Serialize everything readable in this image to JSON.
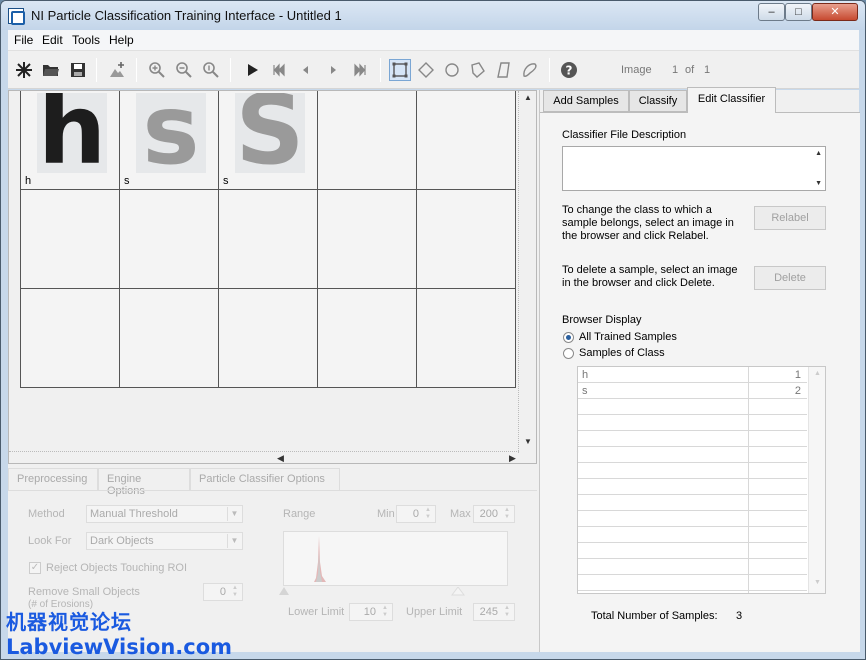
{
  "window": {
    "title": "NI Particle Classification Training Interface - Untitled 1",
    "min": "–",
    "max": "□",
    "close": "✕"
  },
  "menu": [
    "File",
    "Edit",
    "Tools",
    "Help"
  ],
  "toolbar": {
    "icons": [
      "new-icon",
      "open-icon",
      "save-icon",
      "add-samples-icon",
      "zoom-in-icon",
      "zoom-out-icon",
      "zoom-fit-icon",
      "run-icon",
      "first-icon",
      "previous-icon",
      "next-icon",
      "last-icon",
      "rectangle-roi-icon",
      "rotated-rect-icon",
      "ellipse-roi-icon",
      "polygon-icon",
      "freehand-line-icon",
      "freehand-roi-icon",
      "help-icon"
    ],
    "image_label": "Image",
    "image_index": "1",
    "image_of": "of",
    "image_total": "1"
  },
  "browser": {
    "cells": [
      {
        "glyph": "h",
        "label": "h",
        "dark": true
      },
      {
        "glyph": "s",
        "label": "s",
        "dark": false
      },
      {
        "glyph": "S",
        "label": "s",
        "dark": false
      }
    ]
  },
  "lower": {
    "tabs": [
      "Preprocessing",
      "Engine Options",
      "Particle Classifier Options"
    ],
    "method_label": "Method",
    "method_value": "Manual Threshold",
    "lookfor_label": "Look For",
    "lookfor_value": "Dark Objects",
    "reject_label": "Reject Objects Touching ROI",
    "remove_label": "Remove Small Objects",
    "remove_sub": "(# of Erosions)",
    "remove_value": "0",
    "range_label": "Range",
    "min_label": "Min",
    "min_value": "0",
    "max_label": "Max",
    "max_value": "200",
    "lower_limit_label": "Lower Limit",
    "lower_limit_value": "10",
    "upper_limit_label": "Upper Limit",
    "upper_limit_value": "245"
  },
  "right": {
    "tabs": [
      "Add Samples",
      "Classify",
      "Edit Classifier"
    ],
    "active_tab": "Edit Classifier",
    "desc_label": "Classifier File Description",
    "relabel_text": [
      "To change the class to which a",
      "sample belongs, select an image in",
      "the browser and click Relabel."
    ],
    "relabel_button": "Relabel",
    "delete_text": [
      "To delete a sample, select an image",
      "in the browser and click Delete."
    ],
    "delete_button": "Delete",
    "browser_display_label": "Browser Display",
    "radio_all": "All Trained Samples",
    "radio_class": "Samples of Class",
    "classes": [
      {
        "name": "h",
        "count": "1"
      },
      {
        "name": "s",
        "count": "2"
      }
    ],
    "total_label": "Total Number of Samples:",
    "total_value": "3"
  },
  "watermark": {
    "line1": "机器视觉论坛",
    "line2": "LabviewVision.com"
  },
  "colors": {
    "accent": "#1b5fa8",
    "watermark": "#1a5ae0"
  }
}
